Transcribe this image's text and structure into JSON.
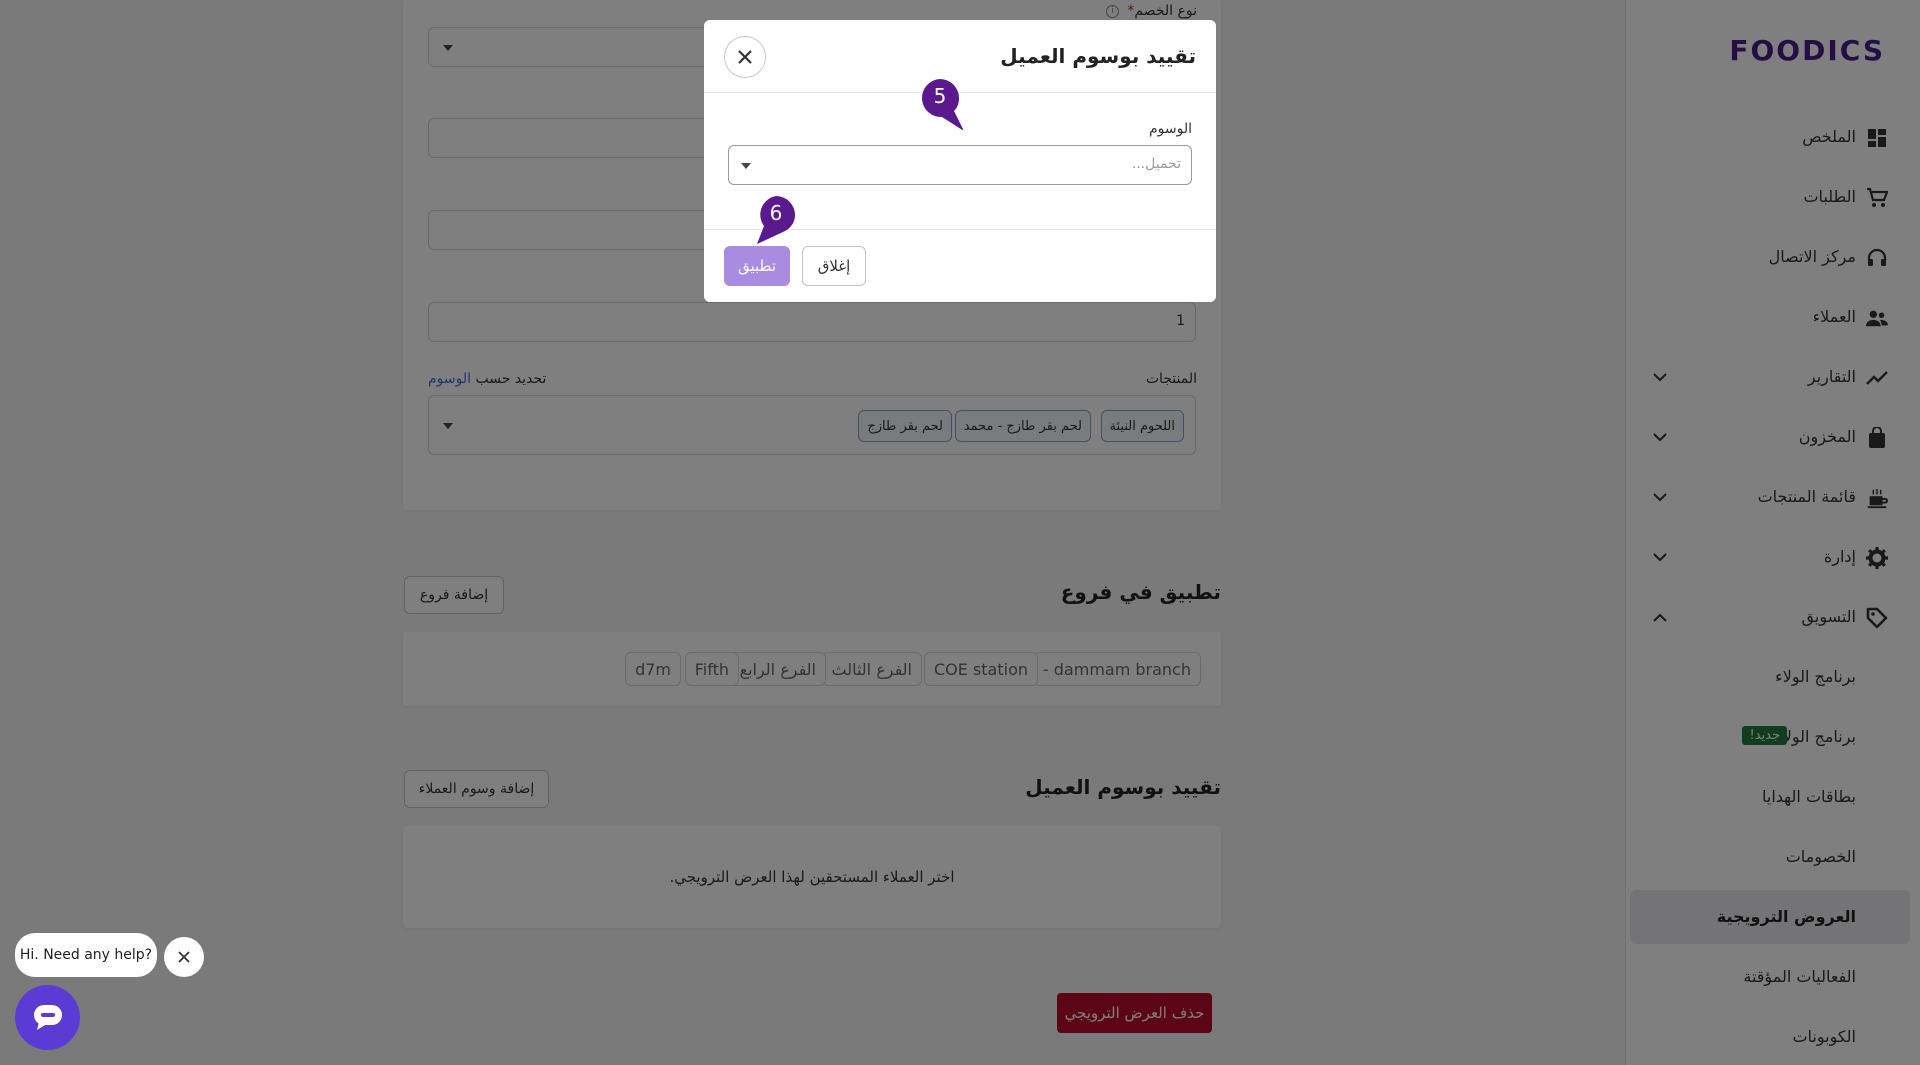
{
  "sidebar": {
    "logo": "FOODICS",
    "items": [
      {
        "label": "الملخص",
        "icon": "dashboard-icon"
      },
      {
        "label": "الطلبات",
        "icon": "cart-icon"
      },
      {
        "label": "مركز الاتصال",
        "icon": "headset-icon"
      },
      {
        "label": "العملاء",
        "icon": "users-icon"
      },
      {
        "label": "التقارير",
        "icon": "chart-line-icon"
      },
      {
        "label": "المخزون",
        "icon": "inventory-bag-icon"
      },
      {
        "label": "قائمة المنتجات",
        "icon": "menu-food-icon"
      },
      {
        "label": "إدارة",
        "icon": "gear-icon"
      },
      {
        "label": "التسويق",
        "icon": "tag-icon"
      }
    ],
    "marketing_sub": [
      {
        "label": "برنامج الولاء"
      },
      {
        "label": "برنامج الولاء",
        "badge": "جديد!"
      },
      {
        "label": "بطاقات الهدايا"
      },
      {
        "label": "الخصومات"
      },
      {
        "label": "العروض الترويجية"
      },
      {
        "label": "الفعاليات المؤقتة"
      },
      {
        "label": "الكوبونات"
      }
    ]
  },
  "form": {
    "discount_type_label": "نوع الخصم",
    "required_mark": "*",
    "quantity_value": "1",
    "products_label": "المنتجات",
    "filter_by_text": "تحديد حسب",
    "filter_by_link": "الوسوم",
    "product_chips": [
      "اللحوم النيئة",
      "لحم بقر طازج - محمد",
      "لحم بقر طازج"
    ]
  },
  "branches": {
    "title": "تطبيق في فروع",
    "add_button": "إضافة فروع",
    "items": [
      "dammam branch -",
      "COE station",
      "الفرع الثالث",
      "الفرع الرابع",
      "Fifth",
      "d7m"
    ]
  },
  "customer_tags": {
    "title": "تقييد بوسوم العميل",
    "add_button": "إضافة وسوم العملاء",
    "empty_text": "اختر العملاء المستحقين لهذا العرض الترويجي."
  },
  "delete_button": "حذف العرض الترويجي",
  "modal": {
    "title": "تقييد بوسوم العميل",
    "tags_label": "الوسوم",
    "tags_placeholder": "تحميل...",
    "apply_button": "تطبيق",
    "close_button": "إغلاق"
  },
  "steps": {
    "first": "5",
    "second": "6"
  },
  "help": {
    "message": "Hi. Need any help?"
  },
  "colors": {
    "brand": "#4a1a8c",
    "apply": "#a98be0",
    "danger": "#b80d2a",
    "step": "#5a1a8e",
    "chat": "#5b3bd4"
  }
}
